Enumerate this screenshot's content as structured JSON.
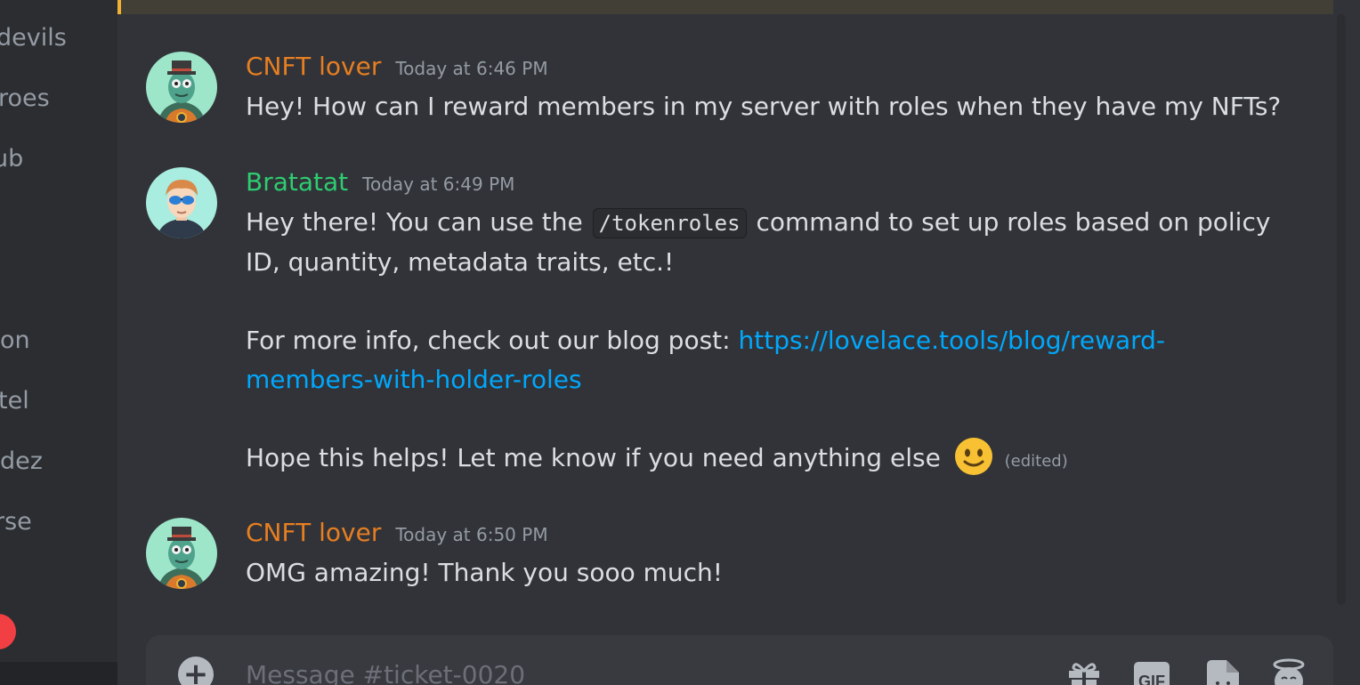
{
  "sidebar": {
    "items": [
      {
        "label": "devils"
      },
      {
        "label": "roes"
      },
      {
        "label": "ub"
      },
      {
        "label": "on"
      },
      {
        "label": "tel"
      },
      {
        "label": "dez"
      },
      {
        "label": "rse"
      }
    ]
  },
  "messages": [
    {
      "username": "CNFT lover",
      "timestamp": "Today at 6:46 PM",
      "line1": "Hey! How can I reward members in my server with roles when they have my NFTs?"
    },
    {
      "username": "Bratatat",
      "timestamp": "Today at 6:49 PM",
      "line1_pre": "Hey there! You can use the",
      "code": "/tokenroles",
      "line1_post": "command to set up roles based on policy",
      "line2": "ID, quantity, metadata traits, etc.!",
      "line3_pre": "For more info, check out our blog post:",
      "link_part1": "https://lovelace.tools/blog/reward-",
      "link_part2": "members-with-holder-roles",
      "line4": "Hope this helps! Let me know if you need anything else",
      "edited": "(edited)"
    },
    {
      "username": "CNFT lover",
      "timestamp": "Today at 6:50 PM",
      "line1": "OMG amazing! Thank you sooo much!"
    }
  ],
  "composer": {
    "placeholder": "Message #ticket-0020",
    "gif_label": "GIF"
  },
  "colors": {
    "cnft_lover": "#e67e22",
    "bratatat": "#2ecc71",
    "link": "#00a8fc"
  },
  "icons": [
    "add-icon",
    "gift-icon",
    "gif-icon",
    "sticker-icon",
    "emoji-icon",
    "slight-smile-emoji"
  ]
}
